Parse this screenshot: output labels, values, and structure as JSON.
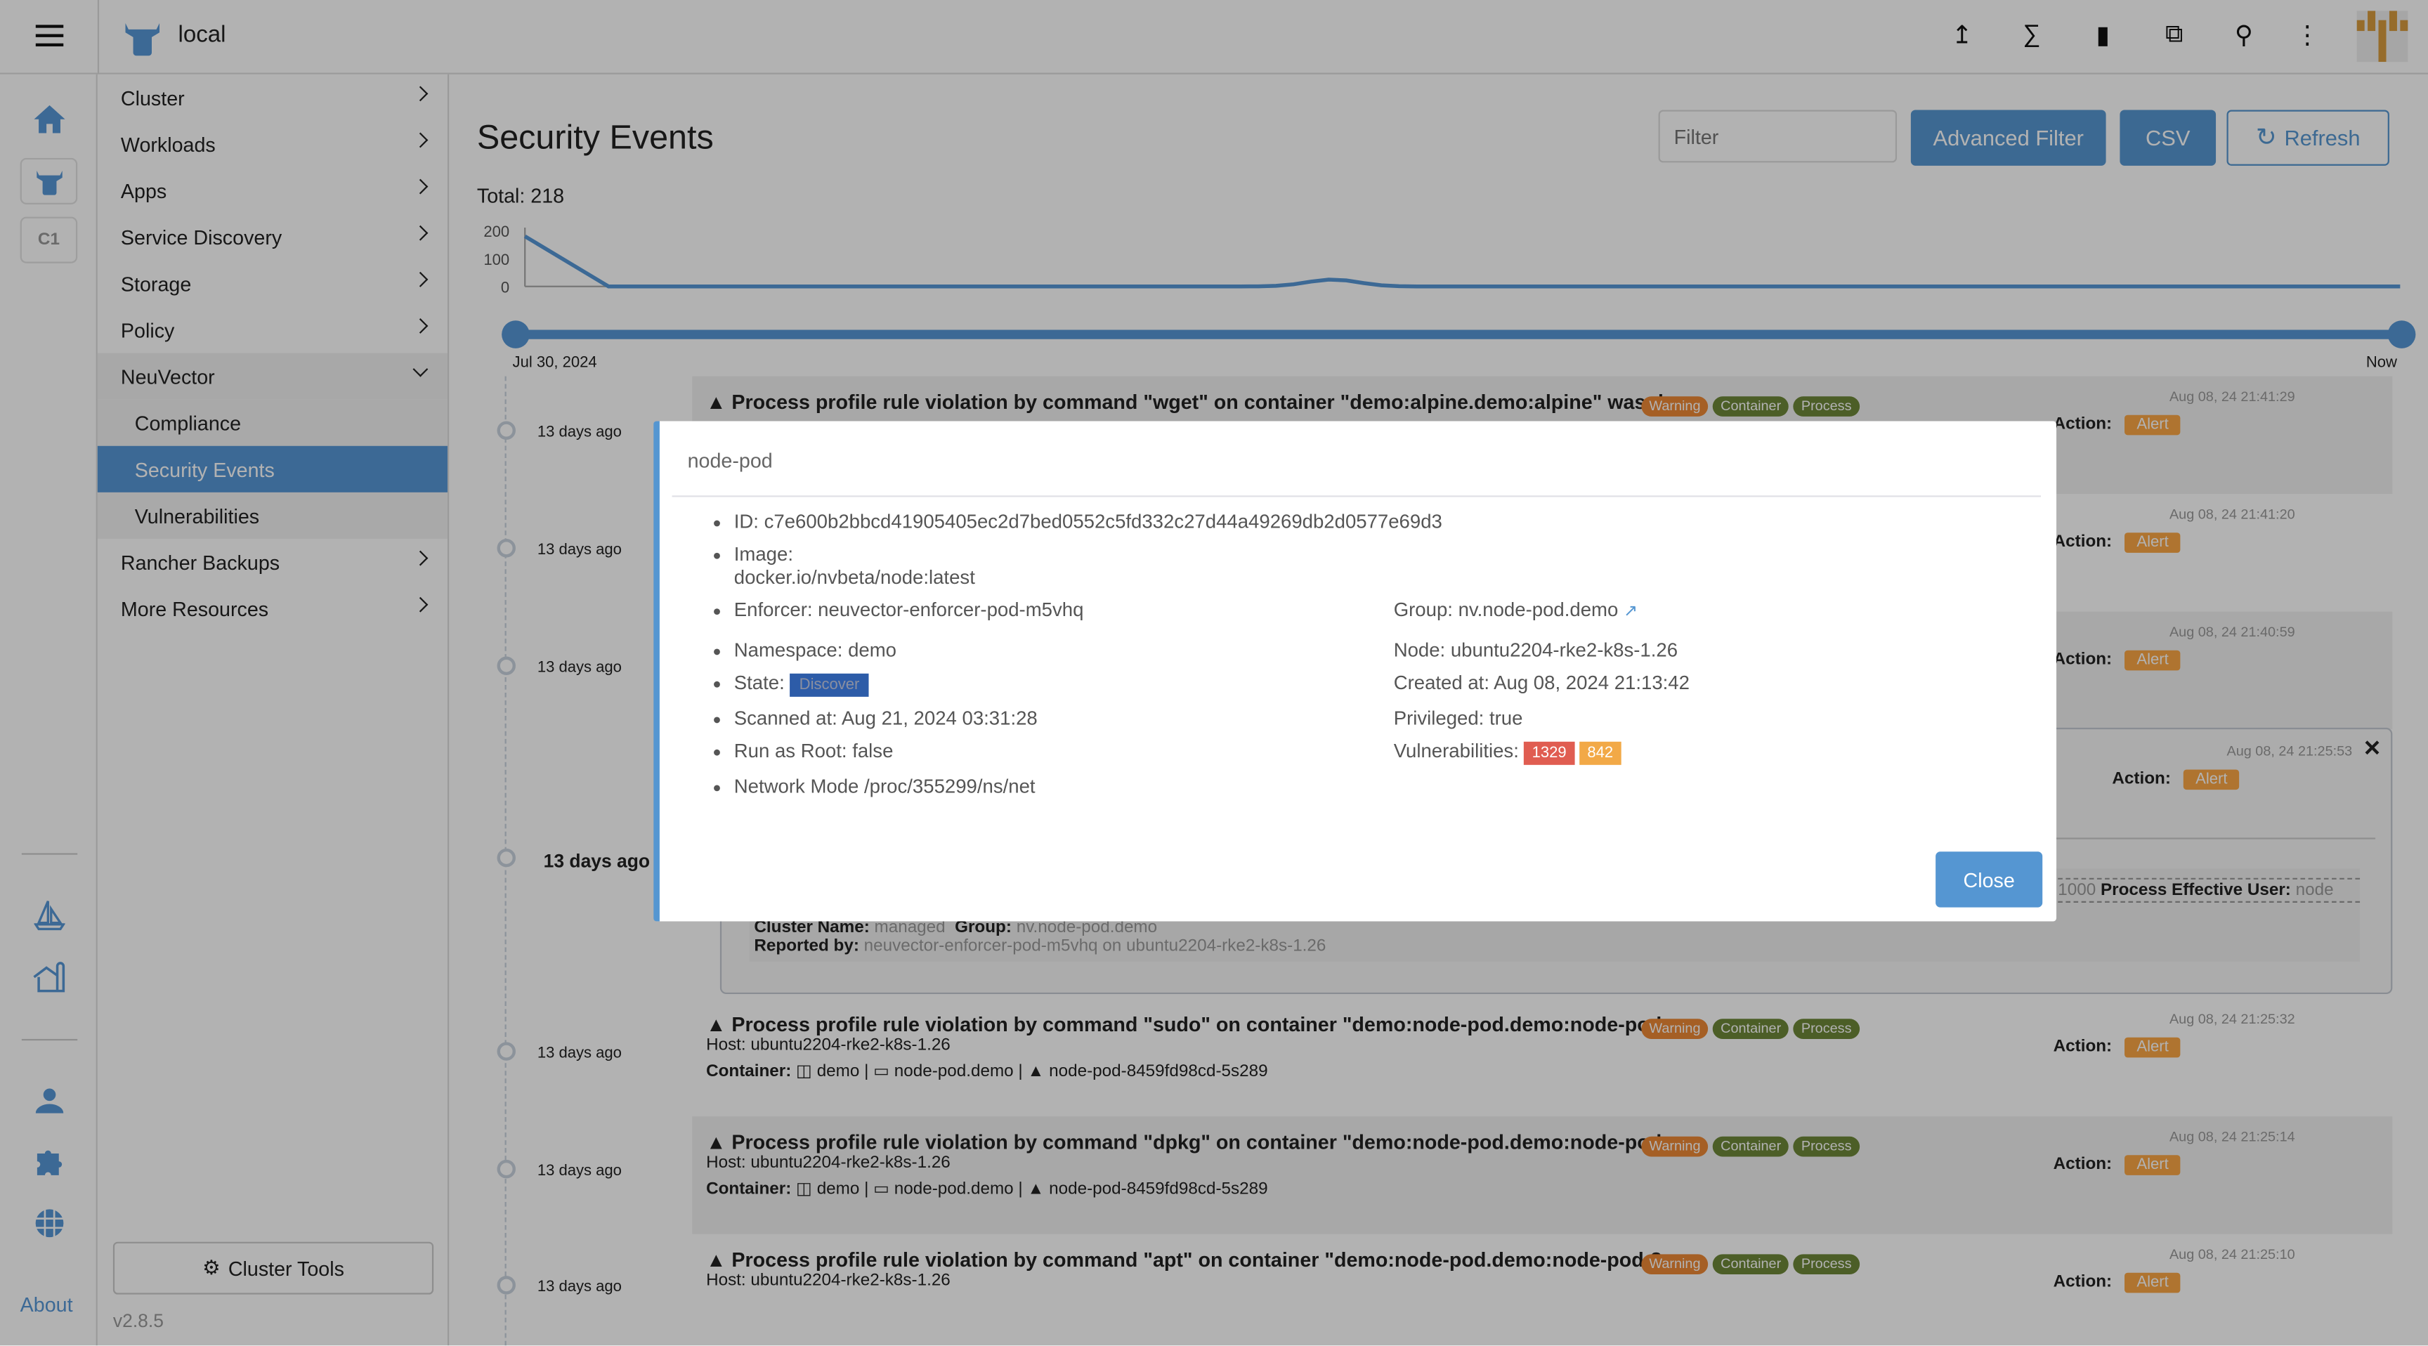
{
  "header": {
    "cluster_name": "local",
    "icons": [
      "upload-icon",
      "terminal-icon",
      "file-icon",
      "copy-icon",
      "search-icon",
      "more-vertical-icon"
    ]
  },
  "rail": {
    "c1_label": "C1",
    "about_label": "About"
  },
  "sidebar": {
    "items": [
      {
        "label": "Cluster",
        "type": "group"
      },
      {
        "label": "Workloads",
        "type": "group"
      },
      {
        "label": "Apps",
        "type": "group"
      },
      {
        "label": "Service Discovery",
        "type": "group"
      },
      {
        "label": "Storage",
        "type": "group"
      },
      {
        "label": "Policy",
        "type": "group"
      },
      {
        "label": "NeuVector",
        "type": "open"
      },
      {
        "label": "Compliance",
        "type": "sub"
      },
      {
        "label": "Security Events",
        "type": "active"
      },
      {
        "label": "Vulnerabilities",
        "type": "sub"
      },
      {
        "label": "Rancher Backups",
        "type": "group"
      },
      {
        "label": "More Resources",
        "type": "group"
      }
    ],
    "cluster_tools_label": "Cluster Tools",
    "version": "v2.8.5"
  },
  "main": {
    "title": "Security Events",
    "filter_placeholder": "Filter",
    "advanced_filter_label": "Advanced Filter",
    "csv_label": "CSV",
    "refresh_label": "Refresh",
    "total": "Total: 218",
    "chart": {
      "y_ticks": [
        "200",
        "100",
        "0"
      ],
      "values": [
        180,
        0,
        0,
        0,
        0,
        0,
        0,
        0,
        0,
        0,
        0,
        0,
        0,
        0,
        0,
        0,
        0,
        0,
        0,
        0,
        0,
        0,
        0,
        0,
        0,
        0,
        0,
        0,
        0,
        0,
        0,
        0,
        0,
        0,
        0,
        0,
        0,
        0,
        0,
        0,
        0,
        0,
        0,
        0,
        0,
        0,
        0,
        0,
        0,
        0,
        0,
        0,
        0,
        0,
        0,
        0,
        0,
        0,
        0,
        0,
        0,
        0,
        0,
        0,
        0,
        0,
        0,
        0,
        0,
        0,
        0,
        0,
        0,
        0,
        0,
        0,
        0,
        0,
        0,
        0,
        0,
        0,
        0,
        0,
        0,
        0,
        0,
        0,
        0,
        0,
        0,
        0,
        0,
        0,
        0,
        0,
        0,
        0,
        0,
        0,
        0,
        0,
        0,
        0
      ],
      "bump": [
        {
          "at": 0.41,
          "value": 25
        }
      ]
    },
    "range": {
      "start_label": "Jul 30, 2024",
      "end_label": "Now",
      "start": 0,
      "end": 1
    }
  },
  "timeline": [
    "13 days ago",
    "13 days ago",
    "13 days ago",
    "13 days ago",
    "13 days ago",
    "13 days ago"
  ],
  "events": [
    {
      "title": "Process profile rule violation by command \"wget\" on container \"demo:alpine.demo:alpine\" was de...",
      "time": "Aug 08, 24 21:41:29",
      "action": "Action:",
      "alert": "Alert",
      "host": "",
      "container": null
    },
    {
      "title": "",
      "time": "Aug 08, 24 21:41:20",
      "action": "Action:",
      "alert": "Alert"
    },
    {
      "title": "",
      "time": "Aug 08, 24 21:40:59",
      "action": "Action:",
      "alert": "Alert"
    },
    {
      "title": "Process profile rule violation by command \"sudo\" on container \"demo:node-pod.demo:node-pod-...",
      "time": "Aug 08, 24 21:25:32",
      "action": "Action:",
      "alert": "Alert",
      "host": "Host: ubuntu2204-rke2-k8s-1.26",
      "container": {
        "label": "Container:",
        "ns": "demo",
        "group": "node-pod.demo",
        "pod": "node-pod-8459fd98cd-5s289"
      }
    },
    {
      "title": "Process profile rule violation by command \"dpkg\" on container \"demo:node-pod.demo:node-pod-...",
      "time": "Aug 08, 24 21:25:14",
      "action": "Action:",
      "alert": "Alert",
      "host": "Host: ubuntu2204-rke2-k8s-1.26",
      "container": {
        "label": "Container:",
        "ns": "demo",
        "group": "node-pod.demo",
        "pod": "node-pod-8459fd98cd-5s289"
      }
    },
    {
      "title": "Process profile rule violation by command \"apt\" on container \"demo:node-pod.demo:node-pod-8...",
      "time": "Aug 08, 24 21:25:10",
      "action": "Action:",
      "alert": "Alert",
      "host": "Host: ubuntu2204-rke2-k8s-1.26",
      "container": null
    }
  ],
  "tags": {
    "warning": "Warning",
    "container": "Container",
    "process": "Process"
  },
  "colors": {
    "warning": "#ed8835",
    "container": "#6d8738",
    "process": "#6d8738",
    "alert": "#fba745",
    "accent": "#5797d6"
  },
  "expanded": {
    "time": "Aug 08, 24 21:25:53",
    "action": "Action:",
    "alert": "Alert",
    "uid_value": "1000",
    "eff_user_label": "Process Effective User:",
    "eff_user_value": "node",
    "cluster_label": "Cluster Name:",
    "cluster_value": "managed",
    "group_label": "Group:",
    "group_value": "nv.node-pod.demo",
    "reported_label": "Reported by:",
    "reported_value": "neuvector-enforcer-pod-m5vhq on ubuntu2204-rke2-k8s-1.26"
  },
  "modal": {
    "title": "node-pod",
    "id": "ID: c7e600b2bbcd41905405ec2d7bed0552c5fd332c27d44a49269db2d0577e69d3",
    "image_label": "Image:",
    "image_value": "docker.io/nvbeta/node:latest",
    "enforcer": "Enforcer: neuvector-enforcer-pod-m5vhq",
    "group": "Group: nv.node-pod.demo",
    "namespace": "Namespace: demo",
    "node": "Node: ubuntu2204-rke2-k8s-1.26",
    "state_label": "State:",
    "state_value": "Discover",
    "created": "Created at: Aug 08, 2024 21:13:42",
    "scanned": "Scanned at: Aug 21, 2024 03:31:28",
    "privileged": "Privileged: true",
    "run_as_root": "Run as Root: false",
    "vuln_label": "Vulnerabilities:",
    "vuln_high": "1329",
    "vuln_medium": "842",
    "network": "Network Mode /proc/355299/ns/net",
    "close_label": "Close"
  }
}
